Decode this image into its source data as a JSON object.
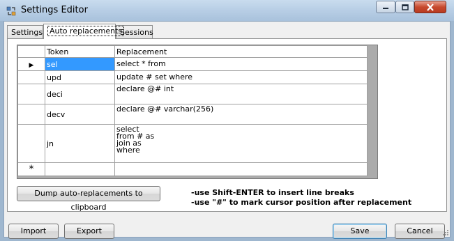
{
  "window": {
    "title": "Settings Editor",
    "icons": {
      "app": "settings-tool-icon",
      "minimize": "minimize-icon",
      "maximize": "maximize-icon",
      "close": "close-icon"
    }
  },
  "tabs": [
    {
      "label": "Settings",
      "selected": false
    },
    {
      "label": "Auto replacements",
      "selected": true
    },
    {
      "label": "Sessions",
      "selected": false
    }
  ],
  "grid": {
    "columns": [
      "Token",
      "Replacement"
    ],
    "rows": [
      {
        "token": "sel",
        "replacement": [
          "select * from"
        ],
        "current": true
      },
      {
        "token": "upd",
        "replacement": [
          "update # set where"
        ],
        "current": false
      },
      {
        "token": "deci",
        "replacement": [
          "declare @# int"
        ],
        "current": false
      },
      {
        "token": "decv",
        "replacement": [
          "declare @# varchar(256)"
        ],
        "current": false
      },
      {
        "token": "jn",
        "replacement": [
          "select",
          "from # as",
          "join as",
          "where"
        ],
        "current": false
      }
    ],
    "new_row_marker": "*",
    "current_row_marker": "▶",
    "selection_color": "#3399ff"
  },
  "dump_button": {
    "label": "Dump auto-replacements to clipboard"
  },
  "hints": [
    "-use Shift-ENTER to insert line breaks",
    "-use \"#\" to mark cursor position after replacement"
  ],
  "footer": {
    "import_label": "Import",
    "export_label": "Export",
    "save_label": "Save",
    "cancel_label": "Cancel"
  }
}
